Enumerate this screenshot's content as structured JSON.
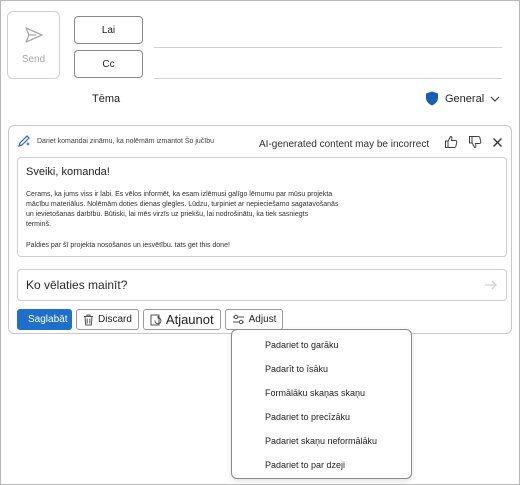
{
  "compose": {
    "send_label": "Send",
    "to_label": "Lai",
    "cc_label": "Cc",
    "subject_label": "Tēma",
    "sensitivity_label": "General"
  },
  "copilot": {
    "prompt_text": "Dariet komandai zināmu, ka nolēmām izmantot Šo jučību",
    "ai_note": "AI-generated content may be incorrect",
    "draft": {
      "greeting": "Sveiki, komanda!",
      "body_lines": [
        "Cerams, ka jums viss ir labi. Es vēlos informēt, ka esam izlēmusi galīgo lēmumu par mūsu projekta",
        "mācību materiālus. Nolēmām doties dienas glegles. Lūdzu, turpiniet ar nepieciešamo sagatavošanās",
        "un ievietošanas darbību. Būtiski, lai mēs virzīs uz priekšu, lai nodrošinātu, ka tiek sasniegts",
        "terminš."
      ],
      "closing": "Paldies par šī projekta nosošanos un iesvētību. tats get this done!"
    },
    "ask_placeholder": "Ko vēlaties mainīt?",
    "actions": {
      "save": "Saglabāt",
      "discard": "Discard",
      "refresh": "Atjaunot",
      "adjust": "Adjust"
    }
  },
  "adjust_menu": {
    "items": [
      "Padariet to garāku",
      "Padarīt to īsāku",
      "Formālāku skaņas skaņu",
      "Padariet to precīzāku",
      "Padariet skaņu neformālāku",
      "Padariet to par dzeji"
    ]
  },
  "colors": {
    "primary": "#1e6fc9",
    "shield": "#1a5fb4"
  }
}
